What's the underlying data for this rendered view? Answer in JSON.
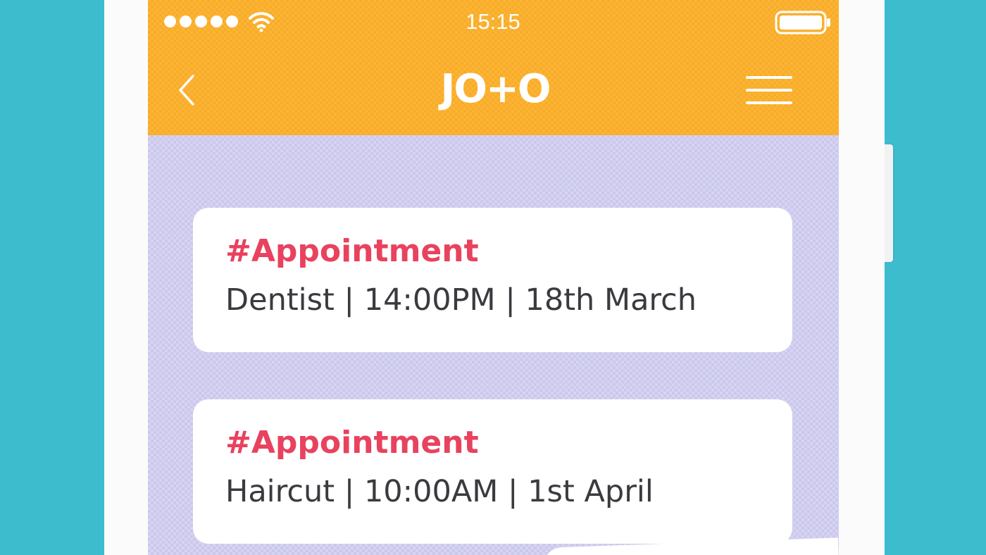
{
  "status_bar": {
    "time": "15:15",
    "signal_icon": "signal-dots-icon",
    "wifi_icon": "wifi-icon",
    "battery_icon": "battery-icon"
  },
  "header": {
    "logo_text": "JO+O",
    "back_icon": "chevron-left-icon",
    "menu_icon": "hamburger-menu-icon",
    "background_color": "#fbb535"
  },
  "appointments": [
    {
      "tag": "#Appointment",
      "details": "Dentist | 14:00PM | 18th March"
    },
    {
      "tag": "#Appointment",
      "details": "Haircut | 10:00AM | 1st April"
    }
  ],
  "colors": {
    "page_background": "#3cbccd",
    "tag_color": "#e8425f",
    "screen_background": "#d6d4f2",
    "text_color": "#3a3a3f"
  }
}
